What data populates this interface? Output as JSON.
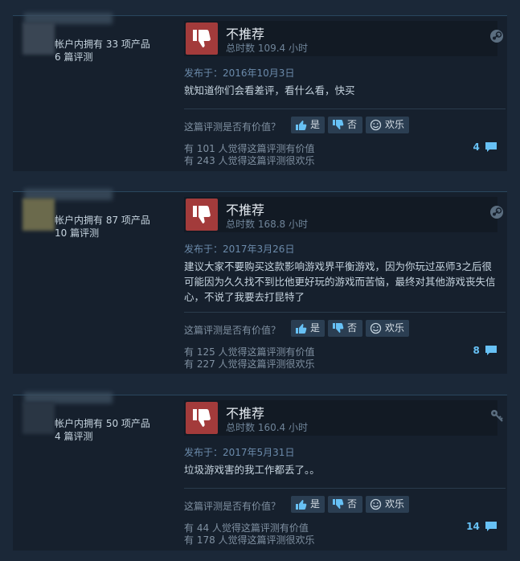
{
  "labels": {
    "posted_prefix": "发布于：",
    "helpful_question": "这篇评测是否有价值？",
    "btn_yes": "是",
    "btn_no": "否",
    "btn_funny": "欢乐"
  },
  "reviews": [
    {
      "author_products": "帐户内拥有 33 项产品",
      "author_reviews": "6 篇评测",
      "verdict": "不推荐",
      "hours": "总时数 109.4 小时",
      "posted": "发布于：2016年10月3日",
      "body": "就知道你们会看差评，看什么看，快买",
      "helpful": "有 101 人觉得这篇评测有价值",
      "funny": "有 243 人觉得这篇评测很欢乐",
      "comments": "4",
      "platform_icon": "steam-icon",
      "avatar_color": "#3a4654"
    },
    {
      "author_products": "帐户内拥有 87 项产品",
      "author_reviews": "10 篇评测",
      "verdict": "不推荐",
      "hours": "总时数 168.8 小时",
      "posted": "发布于：2017年3月26日",
      "body": "建议大家不要购买这款影响游戏界平衡游戏，因为你玩过巫师3之后很可能因为久久找不到比他更好玩的游戏而苦恼，最终对其他游戏丧失信心，不说了我要去打昆特了",
      "helpful": "有 125 人觉得这篇评测有价值",
      "funny": "有 227 人觉得这篇评测很欢乐",
      "comments": "8",
      "platform_icon": "steam-icon",
      "avatar_color": "#6b6a4c"
    },
    {
      "author_products": "帐户内拥有 50 项产品",
      "author_reviews": "4 篇评测",
      "verdict": "不推荐",
      "hours": "总时数 160.4 小时",
      "posted": "发布于：2017年5月31日",
      "body": "垃圾游戏害的我工作都丢了。。",
      "helpful": "有 44 人觉得这篇评测有价值",
      "funny": "有 178 人觉得这篇评测很欢乐",
      "comments": "14",
      "platform_icon": "key-icon",
      "avatar_color": "#2a3644"
    }
  ],
  "colors": {
    "background": "#1b2838",
    "panel": "#16202d",
    "thumb_down": "#a33b3b",
    "comment_link": "#67c1f5"
  }
}
